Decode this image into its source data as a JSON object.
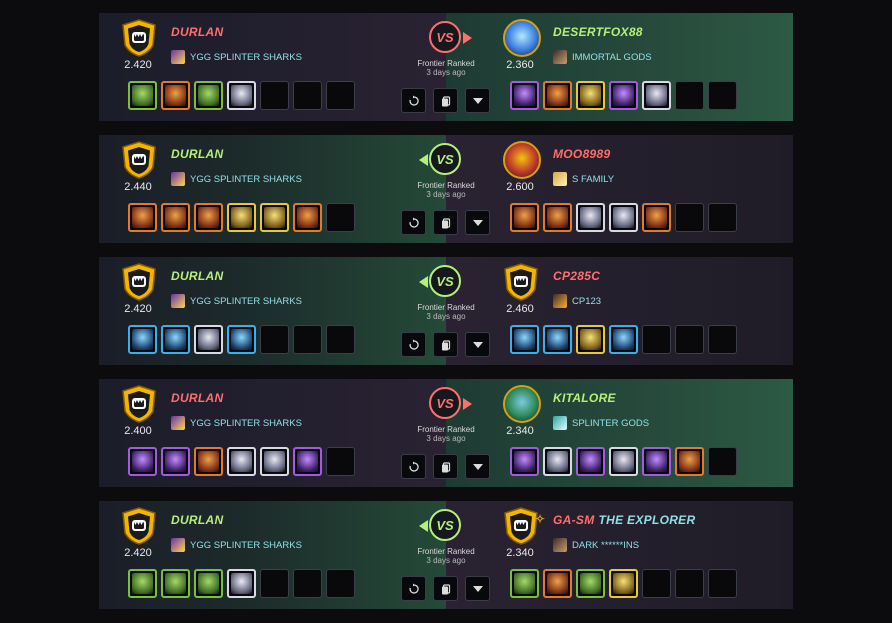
{
  "labels": {
    "match_type": "Frontier Ranked",
    "when": "3 days ago",
    "vs": "VS"
  },
  "colors": {
    "win": "#b6f07a",
    "lose": "#ff6f6f",
    "guild": "#8fe0e6"
  },
  "icons": {
    "replay": "replay-icon",
    "copy": "copy-icon",
    "expand": "chevron-down-icon",
    "shield": "shield-icon"
  },
  "battles": [
    {
      "winner": "right",
      "left": {
        "name": "DURLAN",
        "rating": "2.420",
        "guild": "YGG SPLINTER SHARKS",
        "avatar": "fanged-shield",
        "guild_icon": "purple-bolt",
        "cards": [
          "green",
          "fire",
          "green",
          "white"
        ]
      },
      "right": {
        "name": "DESERTFOX88",
        "name_extra": "",
        "rating": "2.360",
        "guild": "IMMORTAL GODS",
        "avatar": "blue-crystal",
        "guild_icon": "dark-figure",
        "cards": [
          "purple",
          "fire",
          "yellow",
          "purple",
          "white"
        ]
      }
    },
    {
      "winner": "left",
      "left": {
        "name": "DURLAN",
        "rating": "2.440",
        "guild": "YGG SPLINTER SHARKS",
        "avatar": "fanged-shield",
        "guild_icon": "purple-bolt",
        "cards": [
          "fire",
          "fire",
          "fire",
          "yellow",
          "yellow",
          "fire"
        ]
      },
      "right": {
        "name": "MOO8989",
        "name_extra": "",
        "rating": "2.600",
        "guild": "S FAMILY",
        "avatar": "red-ghost",
        "guild_icon": "skull",
        "cards": [
          "fire",
          "fire",
          "white",
          "white",
          "fire"
        ]
      }
    },
    {
      "winner": "left",
      "left": {
        "name": "DURLAN",
        "rating": "2.420",
        "guild": "YGG SPLINTER SHARKS",
        "avatar": "fanged-shield",
        "guild_icon": "purple-bolt",
        "cards": [
          "blue",
          "blue",
          "white",
          "blue"
        ]
      },
      "right": {
        "name": "CP285C",
        "name_extra": "",
        "rating": "2.460",
        "guild": "CP123",
        "avatar": "fanged-shield",
        "guild_icon": "dark-bolt",
        "cards": [
          "blue",
          "blue",
          "yellow",
          "blue"
        ]
      }
    },
    {
      "winner": "right",
      "left": {
        "name": "DURLAN",
        "rating": "2.400",
        "guild": "YGG SPLINTER SHARKS",
        "avatar": "fanged-shield",
        "guild_icon": "purple-bolt",
        "cards": [
          "purple",
          "purple",
          "fire",
          "white",
          "white",
          "purple"
        ]
      },
      "right": {
        "name": "KITALORE",
        "name_extra": "",
        "rating": "2.340",
        "guild": "SPLINTER GODS",
        "avatar": "green-emblem",
        "guild_icon": "cyan-skull",
        "cards": [
          "purple",
          "white",
          "purple",
          "white",
          "purple",
          "fire"
        ]
      }
    },
    {
      "winner": "left",
      "left": {
        "name": "DURLAN",
        "rating": "2.420",
        "guild": "YGG SPLINTER SHARKS",
        "avatar": "fanged-shield",
        "guild_icon": "purple-bolt",
        "cards": [
          "green",
          "green",
          "green",
          "white"
        ]
      },
      "right": {
        "name": "GA-SM",
        "name_extra": "THE EXPLORER",
        "rating": "2.340",
        "guild": "DARK ******INS",
        "avatar": "fanged-shield",
        "guild_icon": "dark-figure",
        "cards": [
          "green",
          "fire",
          "green",
          "yellow"
        ]
      }
    }
  ]
}
